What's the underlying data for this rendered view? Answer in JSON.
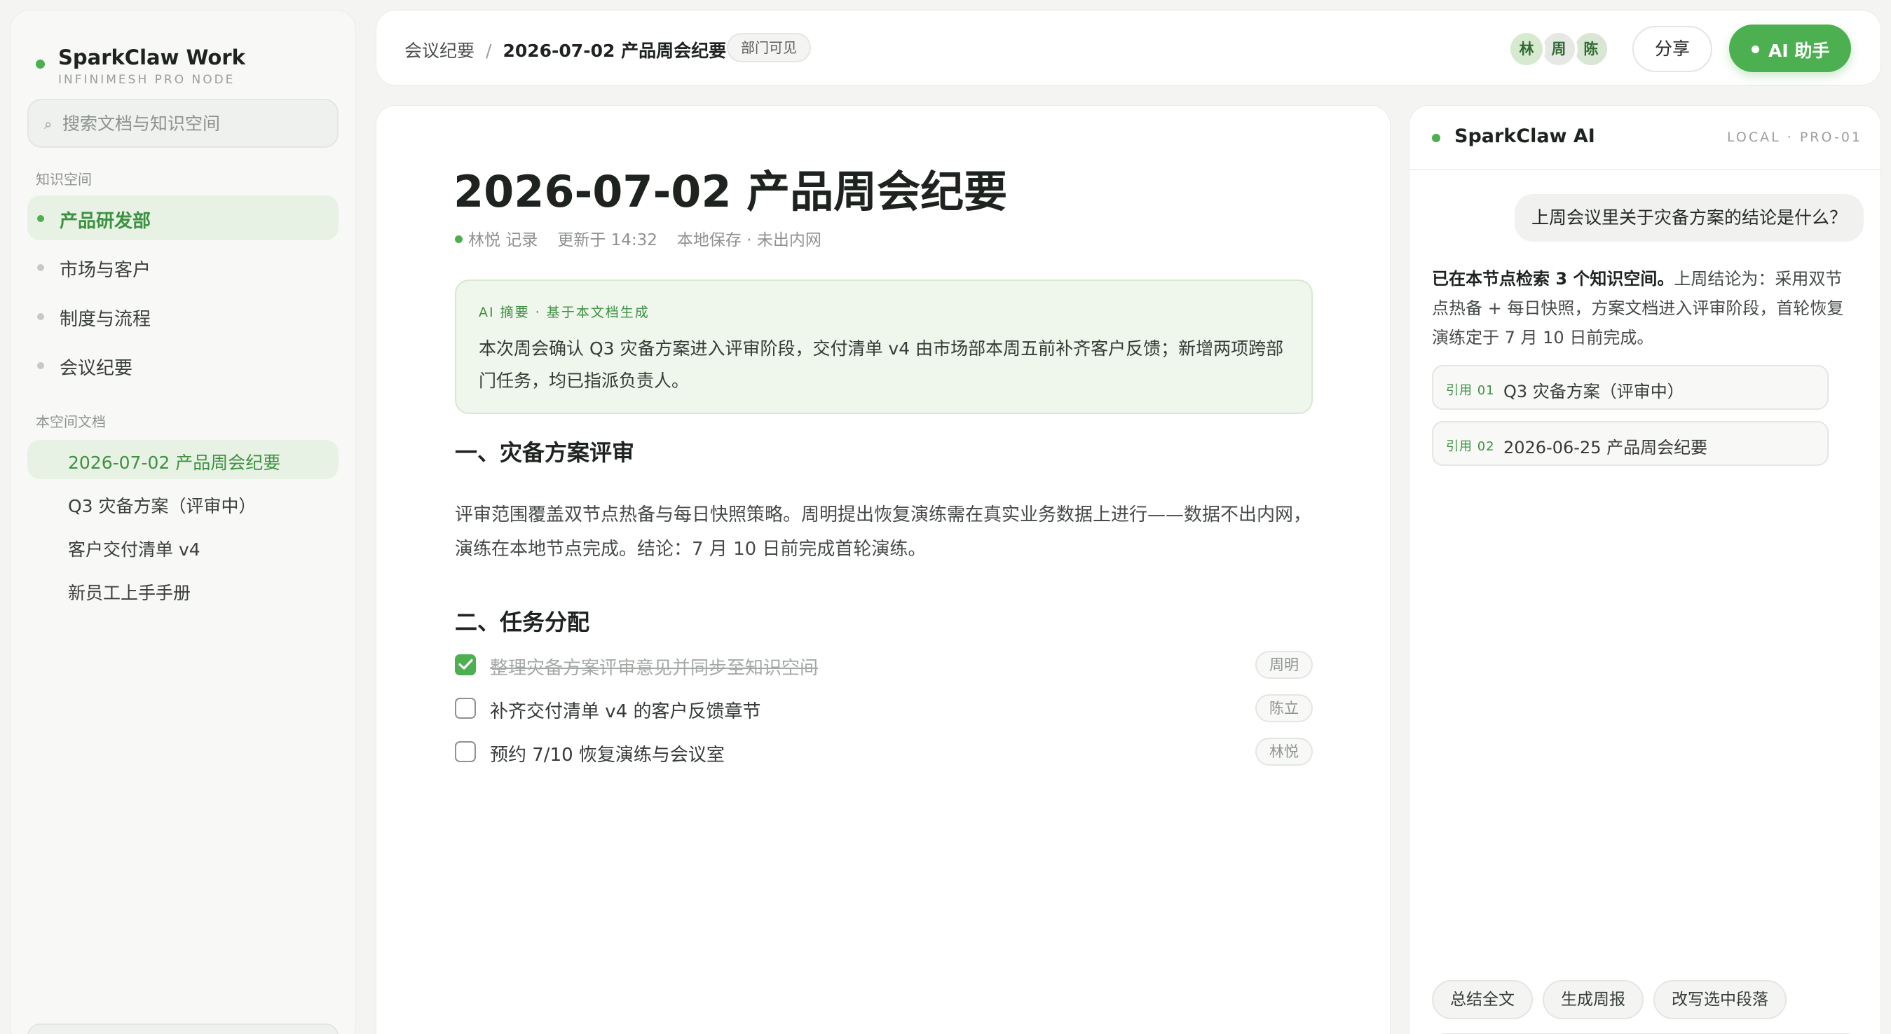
{
  "sidebar": {
    "brand_name": "SparkClaw Work",
    "brand_sub": "INFINIMESH PRO NODE",
    "search_placeholder": "搜索文档与知识空间",
    "spaces_label": "知识空间",
    "spaces": [
      {
        "label": "产品研发部",
        "active": true
      },
      {
        "label": "市场与客户",
        "active": false
      },
      {
        "label": "制度与流程",
        "active": false
      },
      {
        "label": "会议纪要",
        "active": false
      }
    ],
    "docs_label": "本空间文档",
    "docs": [
      {
        "label": "2026-07-02 产品周会纪要",
        "active": true
      },
      {
        "label": "Q3 灾备方案（评审中）",
        "active": false
      },
      {
        "label": "客户交付清单 v4",
        "active": false
      },
      {
        "label": "新员工上手手册",
        "active": false
      }
    ]
  },
  "topbar": {
    "breadcrumb_parent": "会议纪要",
    "breadcrumb_sep": "/",
    "breadcrumb_current": "2026-07-02 产品周会纪要",
    "visibility": "部门可见",
    "avatars": [
      {
        "initial": "林",
        "color": "#d6ead0"
      },
      {
        "initial": "周",
        "color": "#e6e8e4"
      },
      {
        "initial": "陈",
        "color": "#d9e6d4"
      }
    ],
    "share_label": "分享",
    "ai_label": "AI 助手"
  },
  "doc": {
    "title": "2026-07-02 产品周会纪要",
    "author": "林悦 记录",
    "updated": "更新于 14:32",
    "storage": "本地保存 · 未出内网",
    "summary_label": "AI 摘要 · 基于本文档生成",
    "summary_text": "本次周会确认 Q3 灾备方案进入评审阶段，交付清单 v4 由市场部本周五前补齐客户反馈；新增两项跨部门任务，均已指派负责人。",
    "section1_title": "一、灾备方案评审",
    "section1_text": "评审范围覆盖双节点热备与每日快照策略。周明提出恢复演练需在真实业务数据上进行——数据不出内网，演练在本地节点完成。结论：7 月 10 日前完成首轮演练。",
    "section2_title": "二、任务分配",
    "tasks": [
      {
        "text": "整理灾备方案评审意见并同步至知识空间",
        "assignee": "周明",
        "done": true
      },
      {
        "text": "补齐交付清单 v4 的客户反馈章节",
        "assignee": "陈立",
        "done": false
      },
      {
        "text": "预约 7/10 恢复演练与会议室",
        "assignee": "林悦",
        "done": false
      }
    ]
  },
  "ai_panel": {
    "title": "SparkClaw AI",
    "node": "LOCAL · PRO-01",
    "user_question": "上周会议里关于灾备方案的结论是什么？",
    "answer_bold": "已在本节点检索 3 个知识空间。",
    "answer_text": "上周结论为：采用双节点热备 + 每日快照，方案文档进入评审阶段，首轮恢复演练定于 7 月 10 日前完成。",
    "citations": [
      {
        "num": "引用 01",
        "title": "Q3 灾备方案（评审中）"
      },
      {
        "num": "引用 02",
        "title": "2026-06-25 产品周会纪要"
      }
    ],
    "chips": [
      "总结全文",
      "生成周报",
      "改写选中段落"
    ]
  },
  "colors": {
    "accent": "#4caf50",
    "accent_text": "#3d9142",
    "accent_bg": "#e8f2e4",
    "summary_bg": "#eff6ec"
  }
}
